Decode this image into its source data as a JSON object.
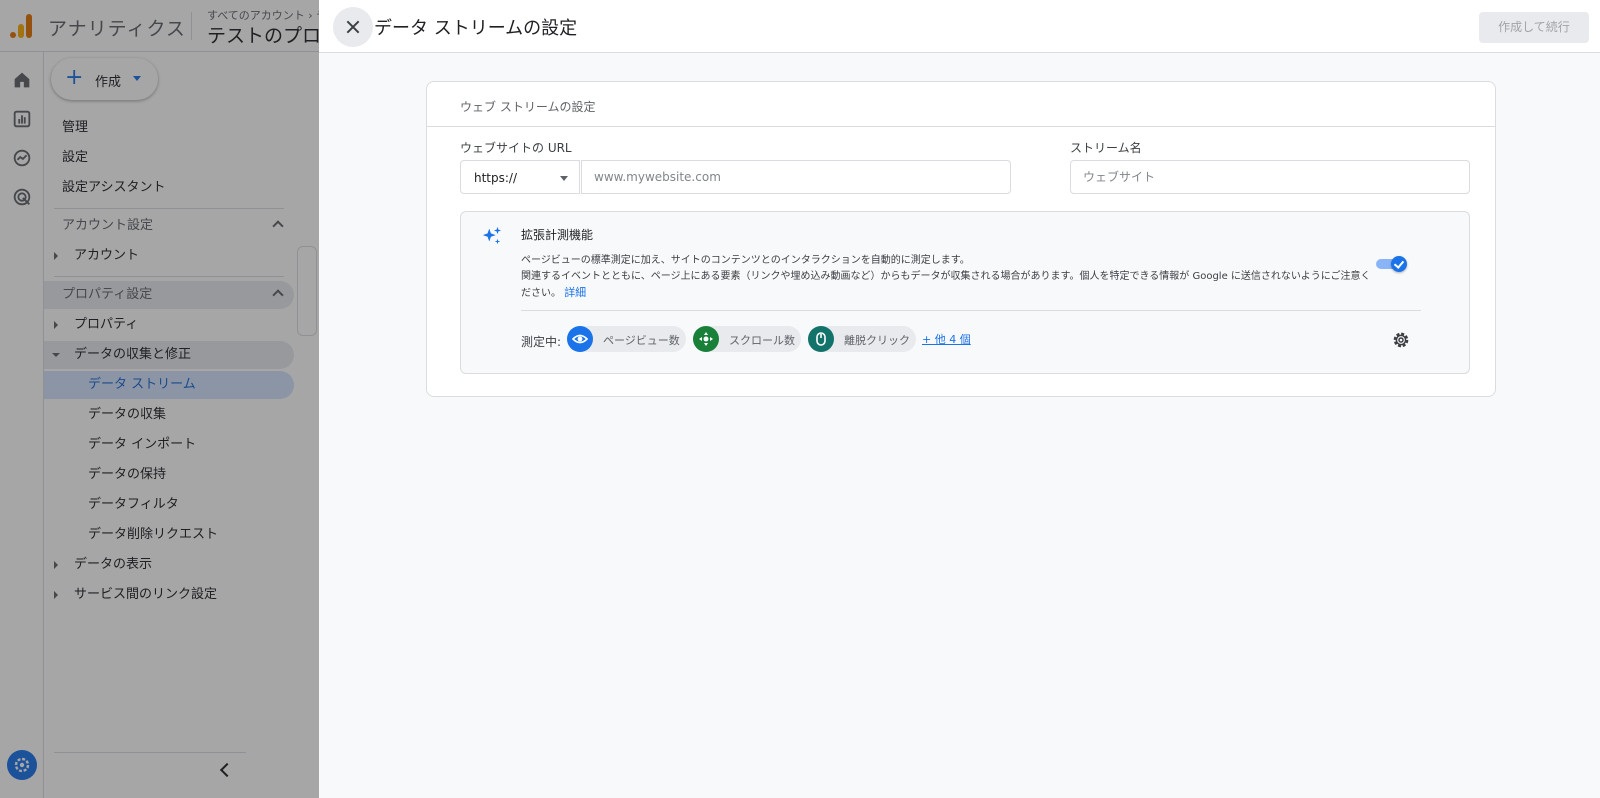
{
  "app": {
    "brand": "アナリティクス",
    "breadcrumb": "すべてのアカウント › テ",
    "property_name": "テストのプロ...",
    "create_label": "作成"
  },
  "nav": {
    "items": [
      {
        "label": "管理"
      },
      {
        "label": "設定"
      },
      {
        "label": "設定アシスタント"
      }
    ],
    "account_section": "アカウント設定",
    "account": "アカウント",
    "property_section": "プロパティ設定",
    "property": "プロパティ",
    "data_collection": "データの収集と修正",
    "sub_items": [
      {
        "label": "データ ストリーム"
      },
      {
        "label": "データの収集"
      },
      {
        "label": "データ インポート"
      },
      {
        "label": "データの保持"
      },
      {
        "label": "データフィルタ"
      },
      {
        "label": "データ削除リクエスト"
      }
    ],
    "data_display": "データの表示",
    "service_links": "サービス間のリンク設定"
  },
  "dialog": {
    "title": "データ ストリームの設定",
    "primary_button": "作成して続行",
    "card_title": "ウェブ ストリームの設定",
    "url_label": "ウェブサイトの URL",
    "protocol_value": "https://",
    "url_placeholder": "www.mywebsite.com",
    "stream_name_label": "ストリーム名",
    "stream_name_placeholder": "ウェブサイト",
    "enhanced": {
      "title": "拡張計測機能",
      "desc_line1": "ページビューの標準測定に加え、サイトのコンテンツとのインタラクションを自動的に測定します。",
      "desc_line2": "関連するイベントとともに、ページ上にある要素（リンクや埋め込み動画など）からもデータが収集される場合があります。個人を特定できる情報が Google に送信されないようにご注意く",
      "desc_line3": "ださい。",
      "learn_more": "詳細",
      "enabled": true,
      "measuring_label": "測定中:",
      "chips": [
        {
          "label": "ページビュー数",
          "icon": "eye-icon",
          "color": "#1a73e8"
        },
        {
          "label": "スクロール数",
          "icon": "scroll-icon",
          "color": "#188038"
        },
        {
          "label": "離脱クリック",
          "icon": "mouse-icon",
          "color": "#12736b"
        }
      ],
      "more": "+ 他 4 個"
    }
  },
  "colors": {
    "accent": "#1a73e8",
    "logo_orange": "#f9ab00",
    "logo_dark_orange": "#e37400"
  }
}
